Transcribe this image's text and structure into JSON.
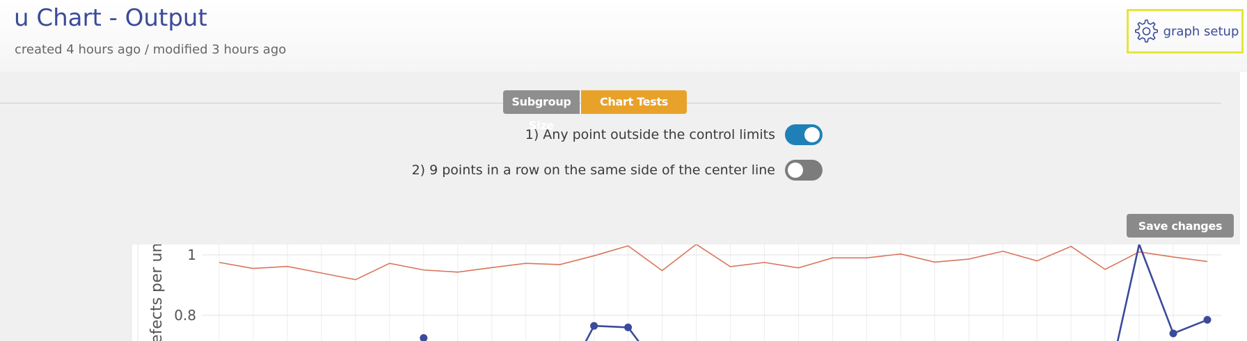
{
  "header": {
    "title": "u Chart - Output",
    "meta": "created 4 hours ago / modified 3 hours ago",
    "graph_setup_label": "graph setup",
    "graph_setup_icon": "gear-icon"
  },
  "settings_panel": {
    "tabs": [
      {
        "label": "Subgroup Size",
        "active": false
      },
      {
        "label": "Chart Tests",
        "active": true
      }
    ],
    "tests": [
      {
        "label": "1) Any point outside the control limits",
        "enabled": true
      },
      {
        "label": "2) 9 points in a row on the same side of the center line",
        "enabled": false
      }
    ],
    "save_label": "Save changes"
  },
  "colors": {
    "accent": "#e8a22a",
    "toggle_on": "#1f80b8",
    "title": "#3b4a9a",
    "limit_line": "#d9745a",
    "data_line": "#3b4a9a",
    "highlight_border": "#e4e63a"
  },
  "chart_data": {
    "type": "line",
    "ylabel": "Defects per unit(u)",
    "yticks": [
      0.8,
      1
    ],
    "ylim": [
      0.72,
      1.04
    ],
    "x": [
      1,
      2,
      3,
      4,
      5,
      6,
      7,
      8,
      9,
      10,
      11,
      12,
      13,
      14,
      15,
      16,
      17,
      18,
      19,
      20,
      21,
      22,
      23,
      24,
      25,
      26,
      27,
      28,
      29,
      30
    ],
    "series": [
      {
        "role": "upper control limit",
        "values": [
          0.975,
          0.955,
          0.962,
          0.94,
          0.918,
          0.972,
          0.95,
          0.943,
          0.958,
          0.972,
          0.968,
          0.997,
          1.03,
          0.948,
          1.035,
          0.961,
          0.975,
          0.957,
          0.99,
          0.99,
          1.003,
          0.976,
          0.986,
          1.012,
          0.98,
          1.028,
          0.952,
          1.01,
          0.993,
          0.978
        ]
      },
      {
        "role": "u values (visible portion)",
        "points": [
          {
            "x": 7,
            "y": 0.725
          },
          {
            "x": 12,
            "y": 0.765
          },
          {
            "x": 13,
            "y": 0.76
          },
          {
            "x": 28,
            "y": 1.035
          },
          {
            "x": 29,
            "y": 0.74
          },
          {
            "x": 30,
            "y": 0.785
          }
        ]
      }
    ]
  }
}
